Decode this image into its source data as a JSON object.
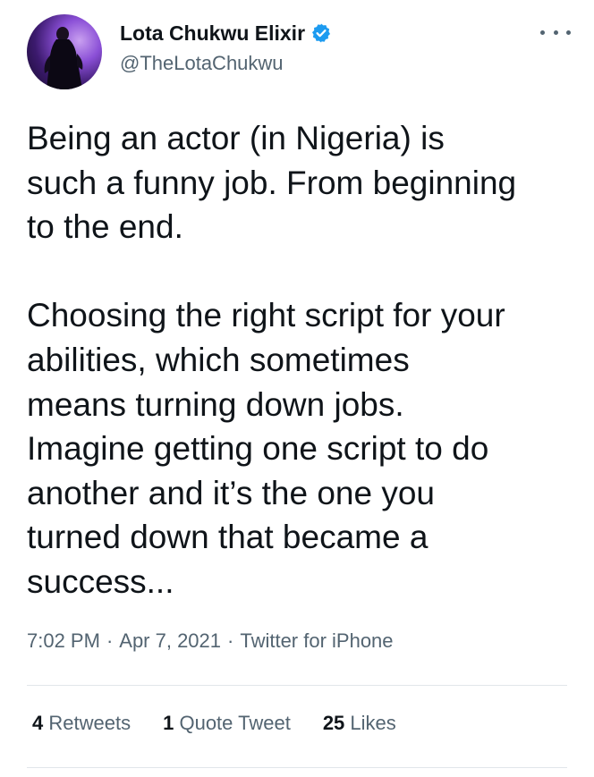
{
  "author": {
    "display_name": "Lota Chukwu Elixir",
    "handle": "@TheLotaChukwu",
    "verified": true,
    "avatar_icon": "profile-photo"
  },
  "tweet": {
    "paragraphs": [
      "Being an actor (in Nigeria) is\nsuch a funny job. From beginning\nto the end.",
      "Choosing the right script for your\nabilities, which sometimes\nmeans turning down jobs.\nImagine getting one script to do\nanother and it’s the one you\nturned down that became a\nsuccess..."
    ],
    "time": "7:02 PM",
    "date": "Apr 7, 2021",
    "source": "Twitter for iPhone",
    "separator": "·"
  },
  "stats": {
    "retweets_count": "4",
    "retweets_label": "Retweets",
    "quotes_count": "1",
    "quotes_label": "Quote Tweet",
    "likes_count": "25",
    "likes_label": "Likes"
  },
  "colors": {
    "text_primary": "#0f1419",
    "text_secondary": "#536471",
    "verified_blue": "#1d9bf0",
    "divider": "#e1e6ea"
  }
}
